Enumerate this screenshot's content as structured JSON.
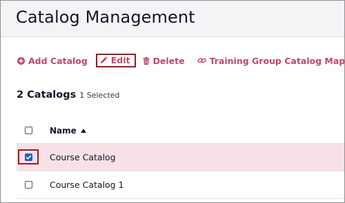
{
  "header": {
    "title": "Catalog Management"
  },
  "toolbar": {
    "add_label": "Add Catalog",
    "edit_label": "Edit",
    "delete_label": "Delete",
    "mapping_label": "Training Group Catalog Mapping",
    "accent_color": "#c1476a"
  },
  "summary": {
    "count": "2 Catalogs",
    "selected": "1 Selected"
  },
  "table": {
    "columns": {
      "name": "Name"
    },
    "sort": {
      "column": "Name",
      "direction": "ascending"
    },
    "rows": [
      {
        "name": "Course Catalog",
        "checked": true
      },
      {
        "name": "Course Catalog 1",
        "checked": false
      }
    ]
  },
  "colors": {
    "selected_row_bg": "#f8e1e6",
    "highlight_border": "#9a1b1b",
    "checkbox_checked": "#1565c0"
  }
}
